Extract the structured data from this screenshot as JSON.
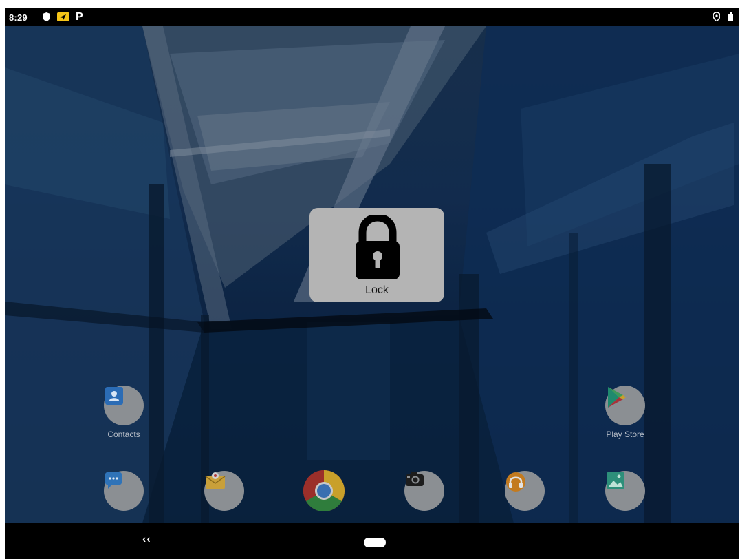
{
  "status_bar": {
    "time": "8:29",
    "icons": [
      "shield-icon",
      "navigation-icon",
      "parking-icon",
      "location-icon",
      "battery-icon"
    ],
    "parking_glyph": "P"
  },
  "overlay": {
    "label": "Lock",
    "icon": "lock-icon"
  },
  "home_apps": [
    {
      "label": "Contacts",
      "icon": "contacts-icon"
    },
    {
      "label": "Play Store",
      "icon": "play-store-icon"
    }
  ],
  "dock_apps": [
    {
      "icon": "messages-icon"
    },
    {
      "icon": "email-icon"
    },
    {
      "icon": "chrome-icon"
    },
    {
      "icon": "camera-icon"
    },
    {
      "icon": "music-icon"
    },
    {
      "icon": "gallery-icon"
    }
  ],
  "nav_bar": {
    "back_glyph": "‹‹",
    "home": "home-pill"
  },
  "colors": {
    "overlay_bg": "#b4b4b4",
    "wallpaper": "#16355e",
    "bars": "#000000"
  }
}
